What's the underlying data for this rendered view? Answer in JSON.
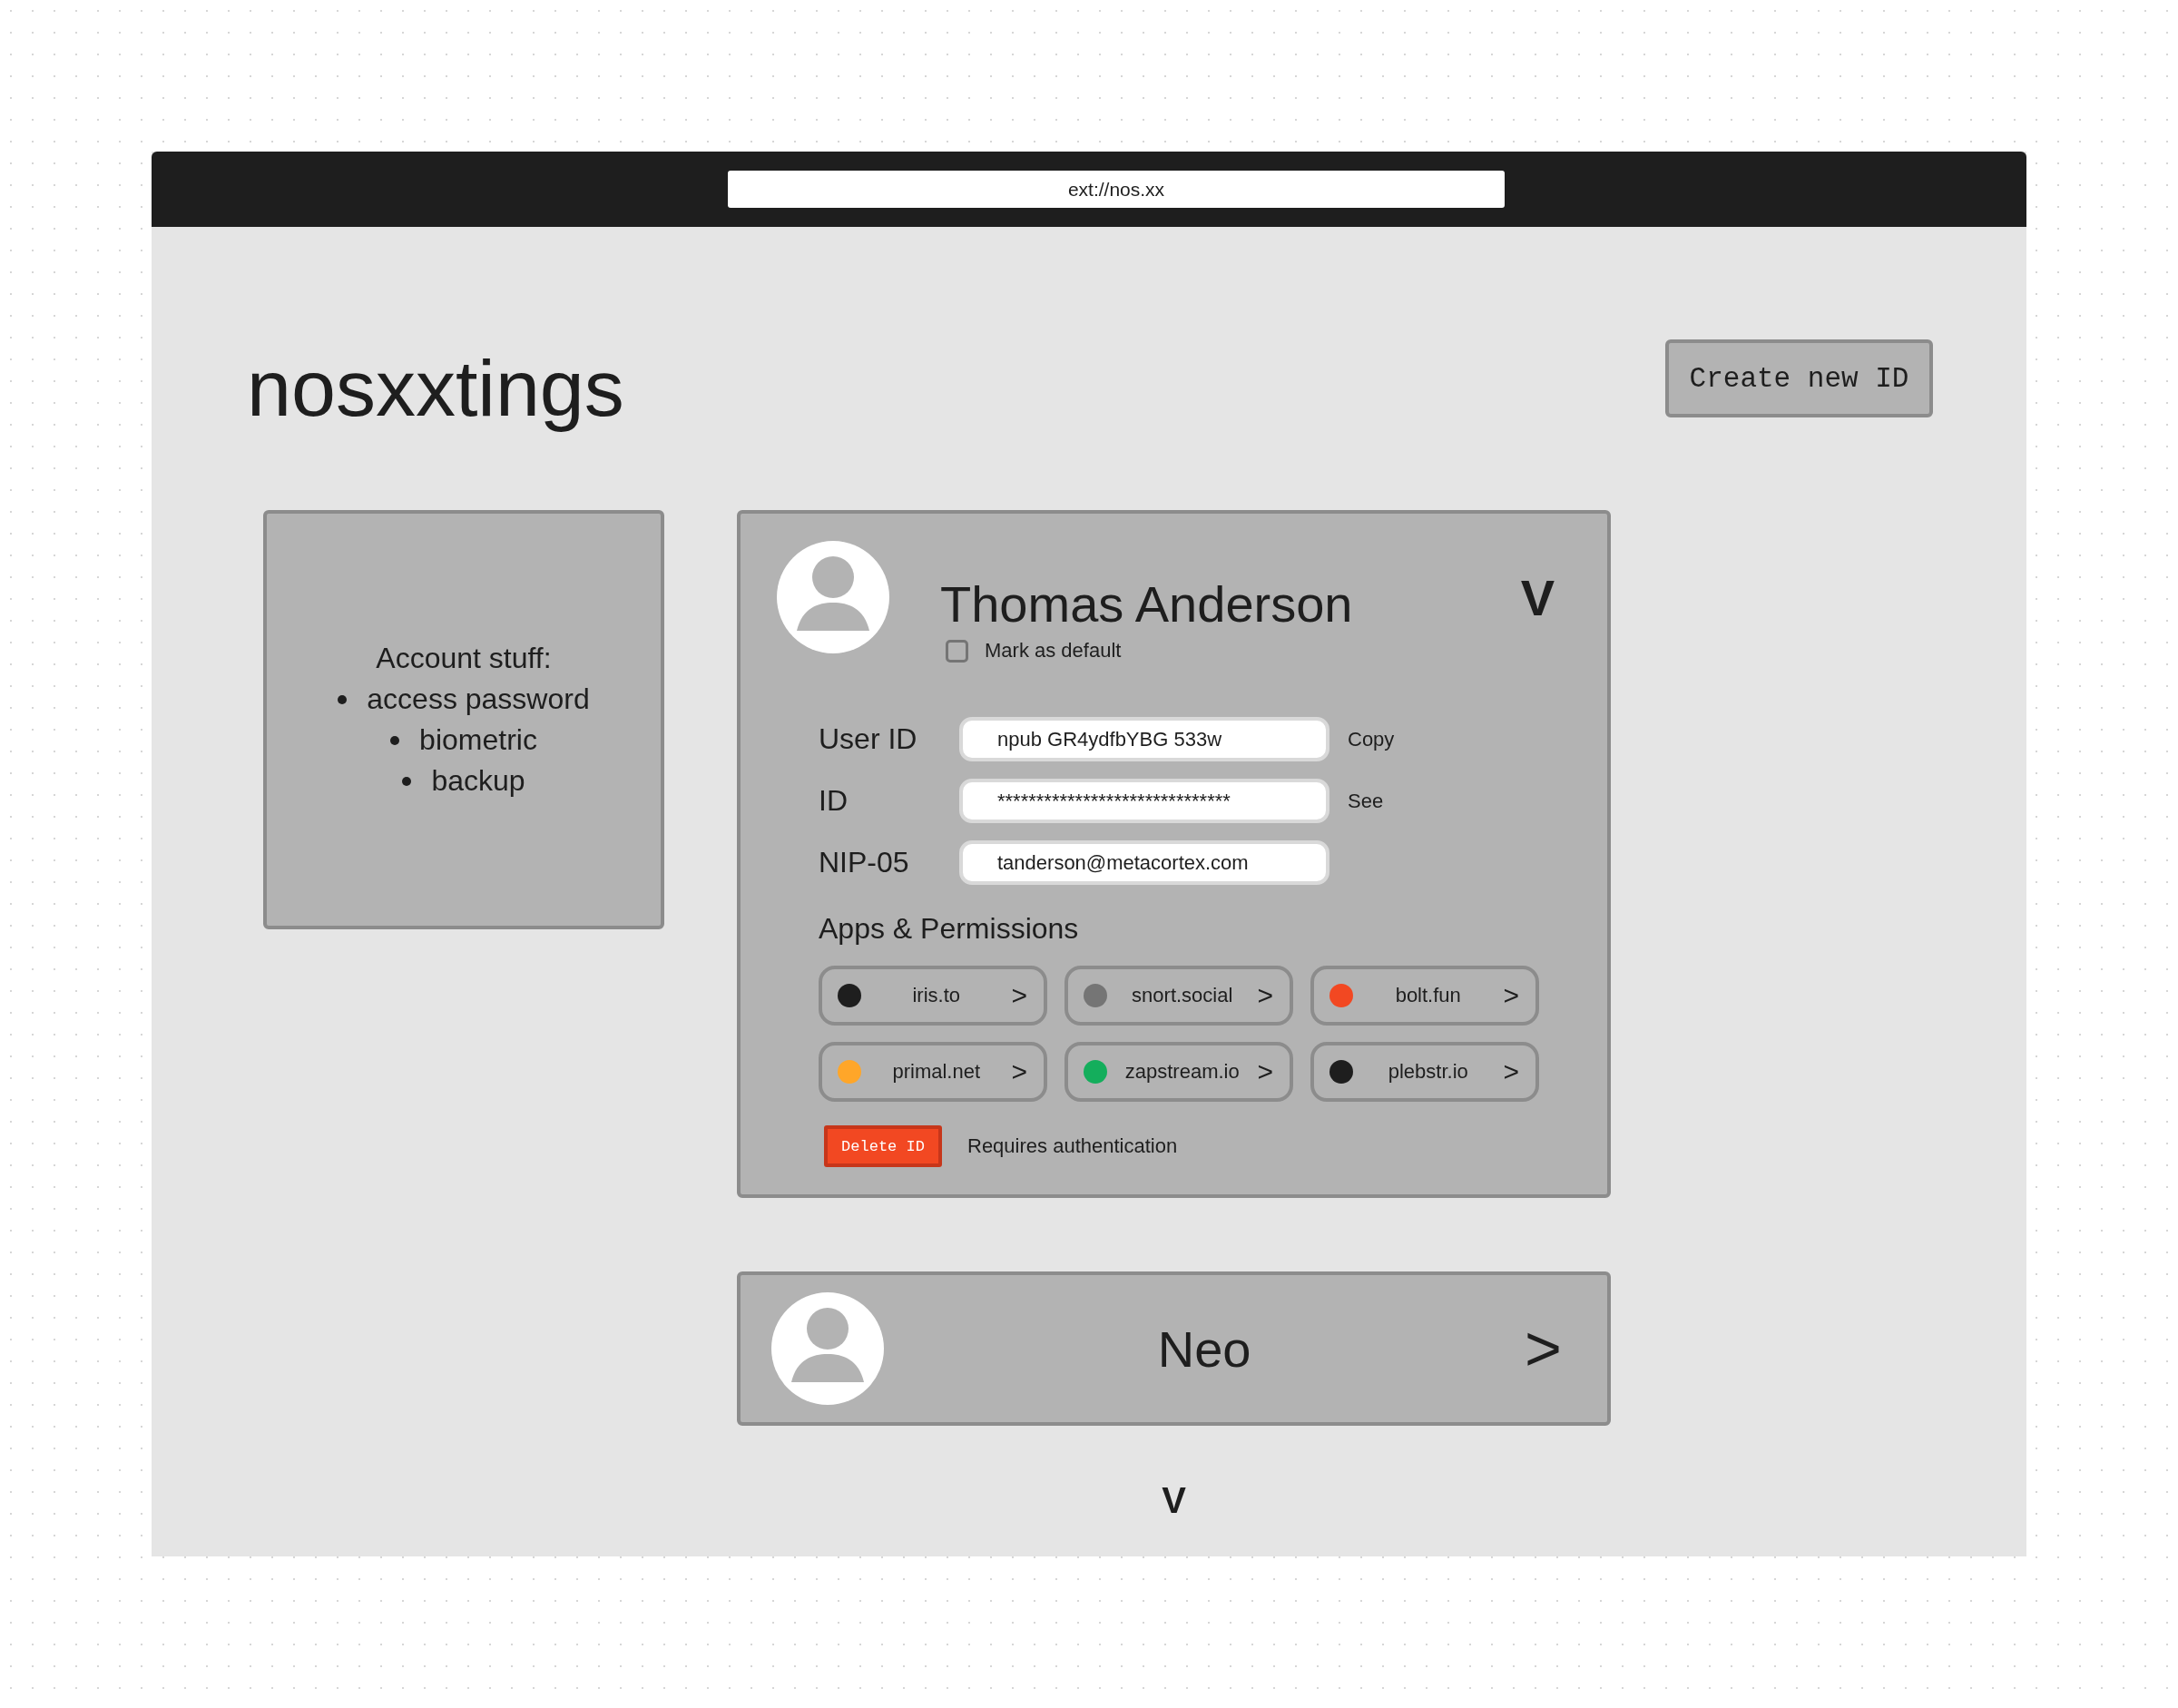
{
  "browser": {
    "url": "ext://nos.xx"
  },
  "header": {
    "title": "nosxxtings",
    "create_button": "Create new ID"
  },
  "account_panel": {
    "heading": "Account stuff:",
    "items": [
      "access password",
      "biometric",
      "backup"
    ]
  },
  "profile_card": {
    "name": "Thomas Anderson",
    "toggle": "V",
    "mark_default": {
      "label": "Mark as default",
      "checked": false
    },
    "fields": [
      {
        "label": "User ID",
        "value": "npub GR4ydfbYBG 533w",
        "action": "Copy"
      },
      {
        "label": "ID",
        "value": "******************************",
        "action": "See"
      },
      {
        "label": "NIP-05",
        "value": "tanderson@metacortex.com"
      }
    ],
    "apps_heading": "Apps & Permissions",
    "apps": [
      {
        "name": "iris.to",
        "arrow": ">",
        "color": "#1e1e1e"
      },
      {
        "name": "snort.social",
        "arrow": ">",
        "color": "#757575"
      },
      {
        "name": "bolt.fun",
        "arrow": ">",
        "color": "#f24822"
      },
      {
        "name": "primal.net",
        "arrow": ">",
        "color": "#ffa629"
      },
      {
        "name": "zapstream.io",
        "arrow": ">",
        "color": "#14ae5c"
      },
      {
        "name": "plebstr.io",
        "arrow": ">",
        "color": "#1e1e1e"
      }
    ],
    "delete_button": "Delete ID",
    "delete_note": "Requires authentication"
  },
  "other_card": {
    "name": "Neo",
    "arrow": ">"
  },
  "more_toggle": "V"
}
